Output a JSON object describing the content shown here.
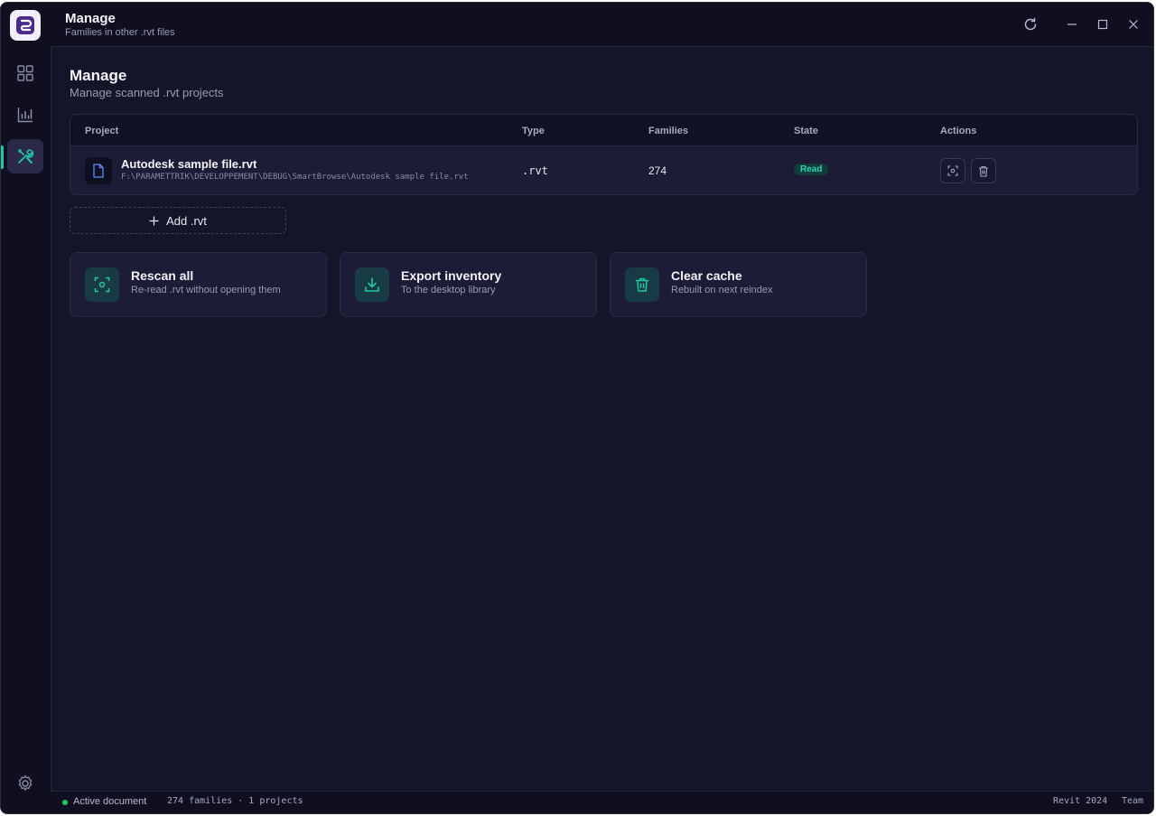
{
  "titlebar": {
    "title": "Manage",
    "subtitle": "Families in other .rvt files",
    "icons": [
      "refresh-icon",
      "minimize-icon",
      "maximize-icon",
      "close-icon"
    ]
  },
  "sidebar": {
    "items": [
      {
        "name": "dashboard",
        "icon": "grid-icon"
      },
      {
        "name": "stats",
        "icon": "chart-icon"
      },
      {
        "name": "manage",
        "icon": "tools-icon",
        "active": true
      }
    ],
    "settings_icon": "gear-icon"
  },
  "page": {
    "title": "Manage",
    "subtitle": "Manage scanned .rvt projects"
  },
  "table": {
    "headers": {
      "project": "Project",
      "type": "Type",
      "families": "Families",
      "state": "State",
      "actions": "Actions"
    },
    "rows": [
      {
        "name": "Autodesk sample file.rvt",
        "path": "F:\\PARAMETTRIK\\DEVELOPPEMENT\\DEBUG\\SmartBrowse\\Autodesk sample file.rvt",
        "type": ".rvt",
        "families": "274",
        "state": "Read"
      }
    ]
  },
  "add_button": {
    "label": "Add .rvt"
  },
  "cards": [
    {
      "title": "Rescan all",
      "subtitle": "Re-read .rvt without opening them",
      "icon": "scan-icon"
    },
    {
      "title": "Export inventory",
      "subtitle": "To the desktop library",
      "icon": "download-icon"
    },
    {
      "title": "Clear cache",
      "subtitle": "Rebuilt on next reindex",
      "icon": "trash-icon"
    }
  ],
  "statusbar": {
    "active": "Active document",
    "summary": "274 families · 1 projects",
    "version": "Revit 2024",
    "mode": "Team"
  },
  "colors": {
    "accent": "#22c5a4",
    "background": "#15152a",
    "panel": "#1c1c36",
    "status_green": "#22c55e"
  }
}
